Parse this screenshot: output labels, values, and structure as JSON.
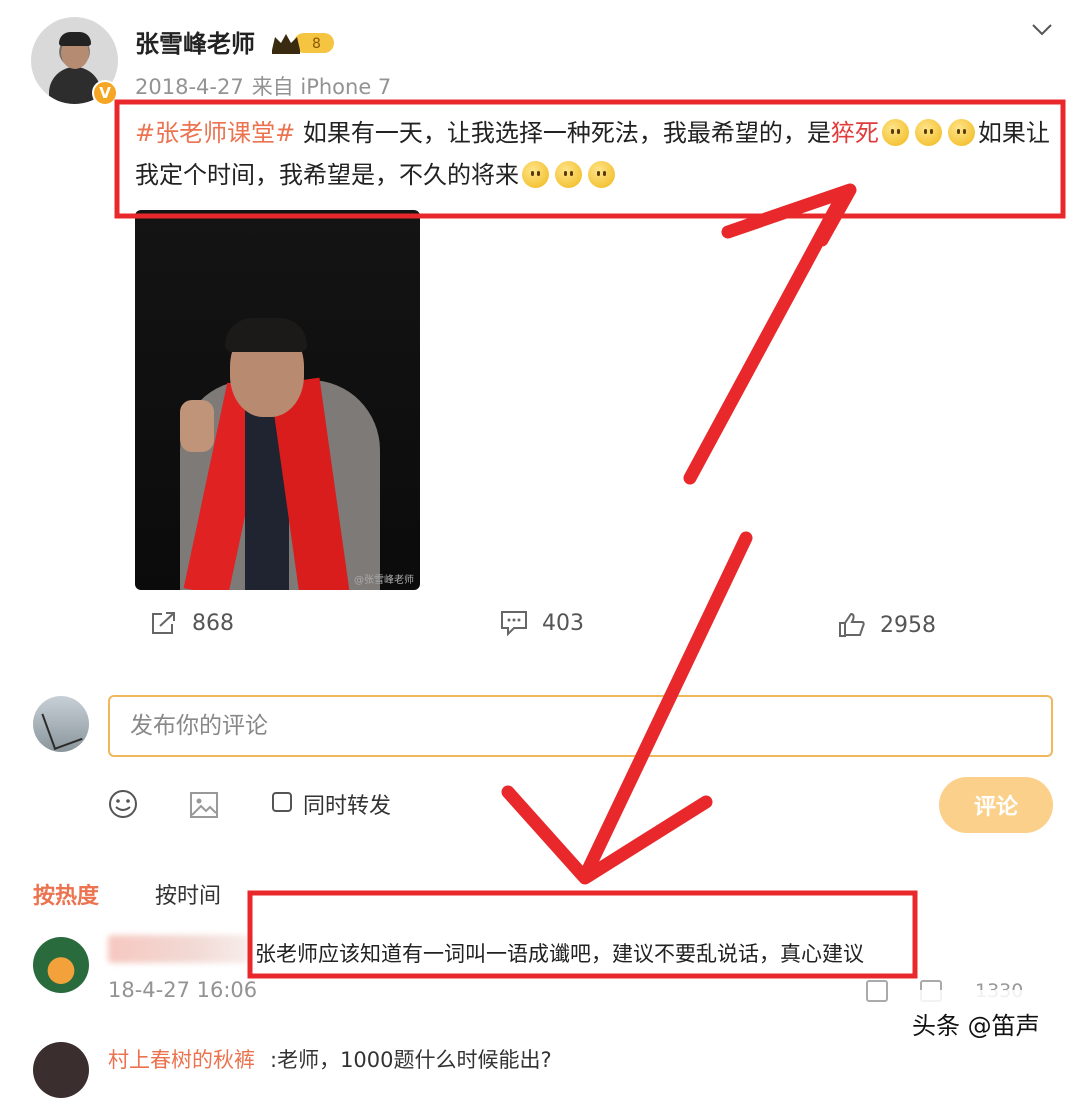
{
  "post": {
    "username": "张雪峰老师",
    "vip_level": "8",
    "date": "2018-4-27",
    "source": "来自 iPhone 7",
    "hashtag": "#张老师课堂#",
    "text_part1": " 如果有一天，让我选择一种死法，我最希望的，是",
    "highlight_word": "猝死",
    "text_part2": "如果让我定个时间，我希望是，不久的将来",
    "emoji_name": "smile-emoji",
    "photo_watermark": "@张雪峰老师"
  },
  "actions": {
    "repost_count": "868",
    "comment_count": "403",
    "like_count": "2958"
  },
  "composer": {
    "placeholder": "发布你的评论",
    "also_repost_label": "同时转发",
    "submit_label": "评论"
  },
  "sort": {
    "hot_label": "按热度",
    "time_label": "按时间"
  },
  "comments": [
    {
      "text": "张老师应该知道有一词叫一语成谶吧，建议不要乱说话，真心建议",
      "time": "18-4-27 16:06",
      "likes": "1330"
    },
    {
      "name": "村上春树的秋裤",
      "text": ":老师，1000题什么时候能出?"
    }
  ],
  "watermark": {
    "text": "头条 @笛声"
  },
  "colors": {
    "accent": "#eb7350",
    "annotation_red": "#e8282b",
    "input_border": "#f0b75c",
    "submit_bg": "#fbd08a"
  }
}
